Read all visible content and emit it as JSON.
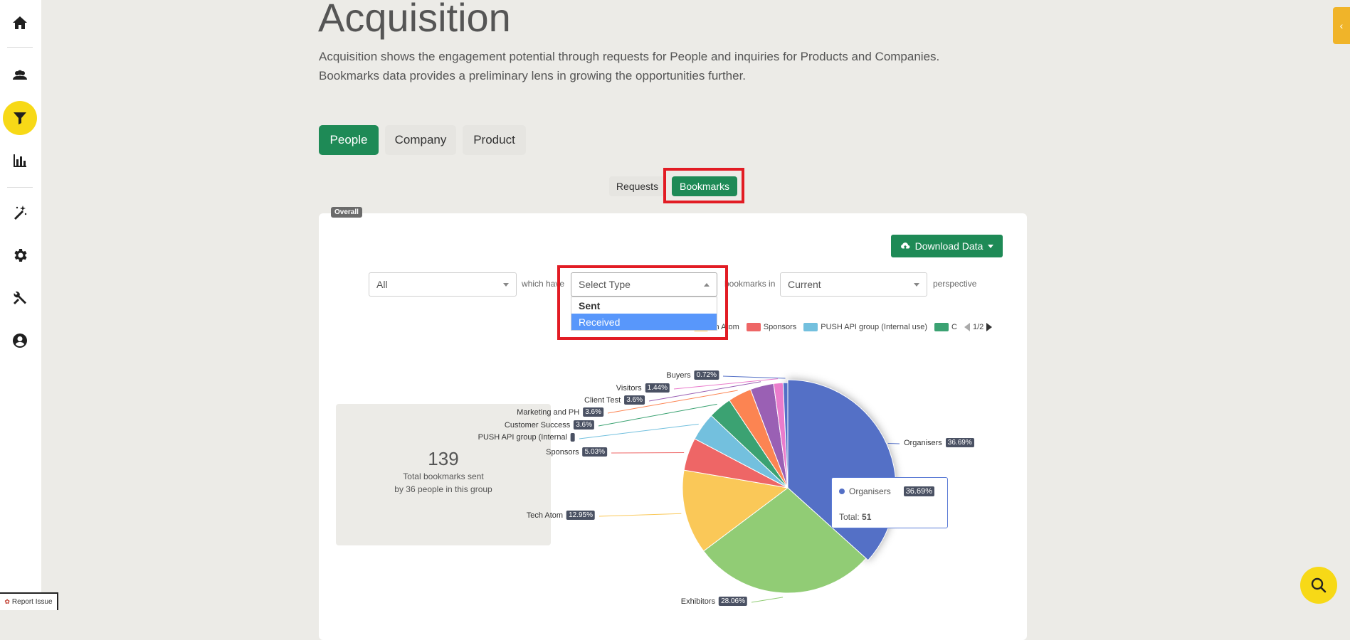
{
  "sidebar": {
    "items": [
      {
        "name": "home-icon"
      },
      {
        "name": "people-icon"
      },
      {
        "name": "filter-icon",
        "active": true
      },
      {
        "name": "bar-chart-icon"
      },
      {
        "name": "magic-wand-icon"
      },
      {
        "name": "gear-icon"
      },
      {
        "name": "tools-icon"
      },
      {
        "name": "user-circle-icon"
      }
    ]
  },
  "header": {
    "title": "Acquisition",
    "description": "Acquisition shows the engagement potential through requests for People and inquiries for Products and Companies. Bookmarks data provides a preliminary lens in growing the opportunities further."
  },
  "tabs": [
    {
      "label": "People",
      "active": true
    },
    {
      "label": "Company",
      "active": false
    },
    {
      "label": "Product",
      "active": false
    }
  ],
  "subtabs": [
    {
      "label": "Requests",
      "active": false
    },
    {
      "label": "Bookmarks",
      "active": true
    }
  ],
  "card": {
    "badge": "Overall",
    "download_label": "Download Data"
  },
  "filters": {
    "group_select": "All",
    "which_have": "which have",
    "type_placeholder": "Select Type",
    "bookmarks_in": "bookmarks in",
    "perspective_select": "Current",
    "perspective": "perspective",
    "type_options": [
      "Sent",
      "Received"
    ],
    "highlighted_option": "Received"
  },
  "legend": {
    "items": [
      {
        "label": "Tech Atom",
        "color": "#fac858",
        "partial_label": "ch Atom"
      },
      {
        "label": "Sponsors",
        "color": "#ee6666"
      },
      {
        "label": "PUSH API group (Internal use)",
        "color": "#73c0de"
      },
      {
        "label": "C",
        "color": "#3ba272"
      }
    ],
    "page": "1/2"
  },
  "stat": {
    "number": "139",
    "line1": "Total bookmarks sent",
    "line2_prefix": "by ",
    "line2_count": "36",
    "line2_suffix": " people in this group"
  },
  "chart_data": {
    "type": "pie",
    "slices": [
      {
        "label": "Organisers",
        "value": 36.69,
        "pct": "36.69%",
        "color": "#5470c6"
      },
      {
        "label": "Exhibitors",
        "value": 28.06,
        "pct": "28.06%",
        "color": "#91cc75"
      },
      {
        "label": "Tech Atom",
        "value": 12.95,
        "pct": "12.95%",
        "color": "#fac858"
      },
      {
        "label": "Sponsors",
        "value": 5.03,
        "pct": "5.03%",
        "color": "#ee6666"
      },
      {
        "label": "PUSH API group (Internal",
        "value": 4.32,
        "pct": "",
        "color": "#73c0de"
      },
      {
        "label": "Customer Success",
        "value": 3.6,
        "pct": "3.6%",
        "color": "#3ba272"
      },
      {
        "label": "Marketing and PH",
        "value": 3.6,
        "pct": "3.6%",
        "color": "#fc8452"
      },
      {
        "label": "Client Test",
        "value": 3.6,
        "pct": "3.6%",
        "color": "#9a60b4"
      },
      {
        "label": "Visitors",
        "value": 1.44,
        "pct": "1.44%",
        "color": "#ea7ccc"
      },
      {
        "label": "Buyers",
        "value": 0.72,
        "pct": "0.72%",
        "color": "#5470c6"
      }
    ]
  },
  "tooltip": {
    "label": "Organisers",
    "pct": "36.69%",
    "total_label": "Total:",
    "total_value": "51"
  },
  "footer": {
    "report_label": "Report Issue"
  },
  "colors": {
    "accent": "#1e8a56",
    "highlight_yellow": "#f7d917",
    "annotation_red": "#e21c24"
  }
}
